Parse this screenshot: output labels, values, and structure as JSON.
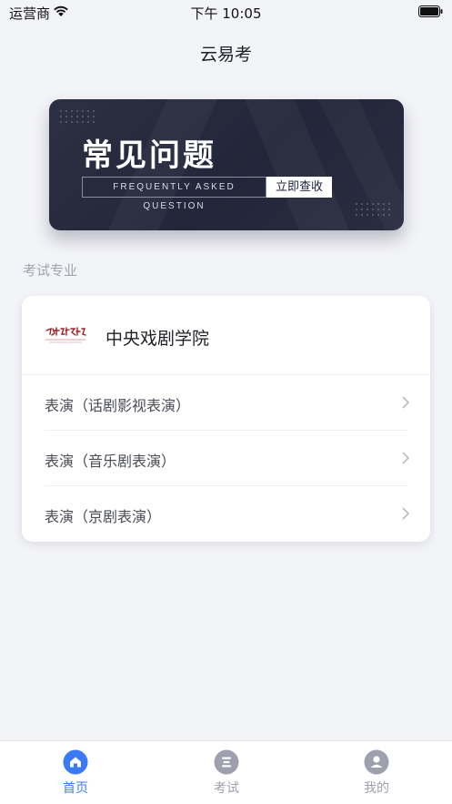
{
  "status_bar": {
    "carrier": "运营商",
    "time": "下午 10:05"
  },
  "nav": {
    "title": "云易考"
  },
  "banner": {
    "title": "常见问题",
    "subtitle": "FREQUENTLY ASKED QUESTION",
    "button": "立即查收"
  },
  "section": {
    "label": "考试专业"
  },
  "school": {
    "name": "中央戏剧学院"
  },
  "majors": [
    {
      "label": "表演（话剧影视表演）"
    },
    {
      "label": "表演（音乐剧表演）"
    },
    {
      "label": "表演（京剧表演）"
    }
  ],
  "tabs": [
    {
      "label": "首页",
      "active": true
    },
    {
      "label": "考试",
      "active": false
    },
    {
      "label": "我的",
      "active": false
    }
  ],
  "colors": {
    "accent": "#3a7bf5",
    "inactive": "#9ea1ad",
    "banner": "#2a2c40"
  }
}
